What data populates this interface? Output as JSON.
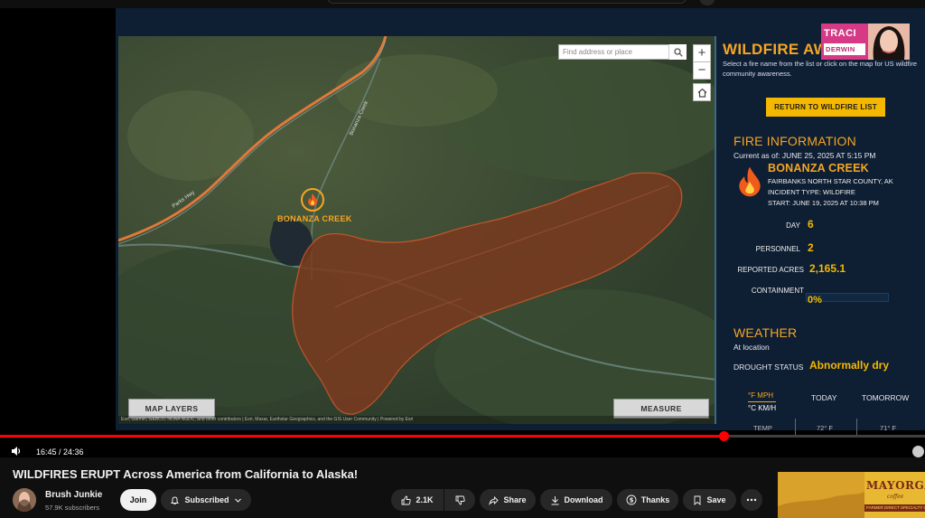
{
  "map": {
    "search_placeholder": "Find address or place",
    "zoom_in": "+",
    "zoom_out": "−",
    "fire_label": "BONANZA CREEK",
    "road_label_1": "Parks Hwy",
    "road_label_2": "Bonanza Creek",
    "map_layers_btn": "MAP LAYERS",
    "measure_btn": "MEASURE",
    "attribution": "Esri, Garmin, GEBCO, NOAA NGDC, and other contributors | Esri, Maxar, Earthstar Geographics, and the GIS User Community | Powered by Esri"
  },
  "panel": {
    "app_title": "WILDFIRE AWARE - LIST",
    "description": "Select a fire name from the list or click on the map for US wildfire community awareness.",
    "return_btn": "RETURN TO WILDFIRE LIST",
    "fire_info_title": "FIRE INFORMATION",
    "current_as_of": "Current as of: JUNE 25, 2025 AT 5:15 PM",
    "fire_name": "BONANZA CREEK",
    "county": "FAIRBANKS NORTH STAR COUNTY, AK",
    "incident_type": "INCIDENT TYPE: WILDFIRE",
    "start": "START: JUNE 19, 2025 AT 10:38 PM",
    "day_label": "DAY",
    "day_value": "6",
    "personnel_label": "PERSONNEL",
    "personnel_value": "2",
    "acres_label": "REPORTED ACRES",
    "acres_value": "2,165.1",
    "containment_label": "CONTAINMENT",
    "containment_value": "0%",
    "weather_title": "WEATHER",
    "at_location": "At location",
    "drought_label": "DROUGHT STATUS",
    "drought_value": "Abnormally dry",
    "unit_imperial": "°F MPH",
    "unit_metric": "°C KM/H",
    "today": "TODAY",
    "tomorrow": "TOMORROW",
    "temp_label": "TEMP",
    "temp_today": "72° F",
    "temp_tomorrow": "71° F"
  },
  "streamer": {
    "name1": "TRACI",
    "name2": "DERWIN"
  },
  "player": {
    "time": "16:45 / 24:36",
    "progress": 0.782
  },
  "video": {
    "title": "WILDFIRES ERUPT Across America from California to Alaska!",
    "channel": "Brush Junkie",
    "subscribers": "57.9K subscribers",
    "join": "Join",
    "subscribed": "Subscribed",
    "likes": "2.1K",
    "share": "Share",
    "download": "Download",
    "thanks": "Thanks",
    "save": "Save"
  },
  "ad": {
    "brand": "MAYORGA",
    "sub": "coffee",
    "strip": "FARMER DIRECT SPECIALTY GRADE"
  },
  "colors": {
    "accent": "#f5a623",
    "panel_bg": "#0e1e33",
    "burn_area": "#7a3a1f",
    "progress": "#ff0000"
  }
}
